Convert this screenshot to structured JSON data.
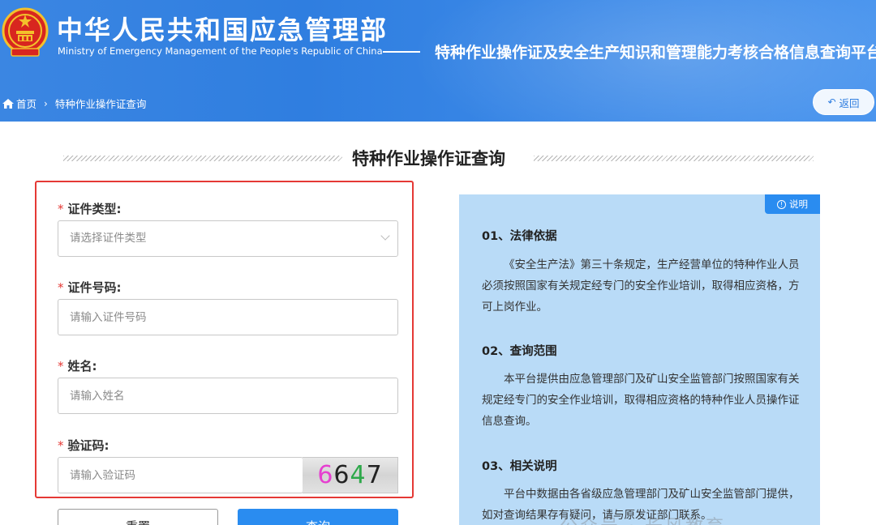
{
  "header": {
    "org_title": "中华人民共和国应急管理部",
    "org_subtitle": "Ministry of Emergency Management of the People's Republic of China",
    "platform_title": "特种作业操作证及安全生产知识和管理能力考核合格信息查询平台"
  },
  "breadcrumb": {
    "home": "首页",
    "separator": "›",
    "current": "特种作业操作证查询"
  },
  "back_button": {
    "label": "返回",
    "icon": "undo-arrow-icon"
  },
  "section_title": "特种作业操作证查询",
  "form": {
    "required_mark": "*",
    "cert_type": {
      "label": "证件类型:",
      "placeholder": "请选择证件类型"
    },
    "cert_number": {
      "label": "证件号码:",
      "placeholder": "请输入证件号码"
    },
    "name": {
      "label": "姓名:",
      "placeholder": "请输入姓名"
    },
    "captcha": {
      "label": "验证码:",
      "placeholder": "请输入验证码",
      "digits": [
        {
          "char": "6",
          "color": "#e63fd0"
        },
        {
          "char": "6",
          "color": "#222222"
        },
        {
          "char": "4",
          "color": "#2ea84a"
        },
        {
          "char": "7",
          "color": "#222222"
        }
      ]
    },
    "reset_label": "重置",
    "submit_label": "查询"
  },
  "info": {
    "tag_label": "说明",
    "sections": [
      {
        "heading": "01、法律依据",
        "text": "《安全生产法》第三十条规定，生产经营单位的特种作业人员必须按照国家有关规定经专门的安全作业培训，取得相应资格，方可上岗作业。"
      },
      {
        "heading": "02、查询范围",
        "text": "本平台提供由应急管理部门及矿山安全监管部门按照国家有关规定经专门的安全作业培训，取得相应资格的特种作业人员操作证信息查询。"
      },
      {
        "heading": "03、相关说明",
        "text": "平台中数据由各省级应急管理部门及矿山安全监管部门提供，如对查询结果存有疑问，请与原发证部门联系。"
      }
    ]
  },
  "watermark": "公众号 · 长风教育",
  "colors": {
    "header_blue": "#2f7ee0",
    "primary_button": "#2a8cf0",
    "required_red": "#e53935",
    "info_panel_bg": "#b9dbf7"
  }
}
